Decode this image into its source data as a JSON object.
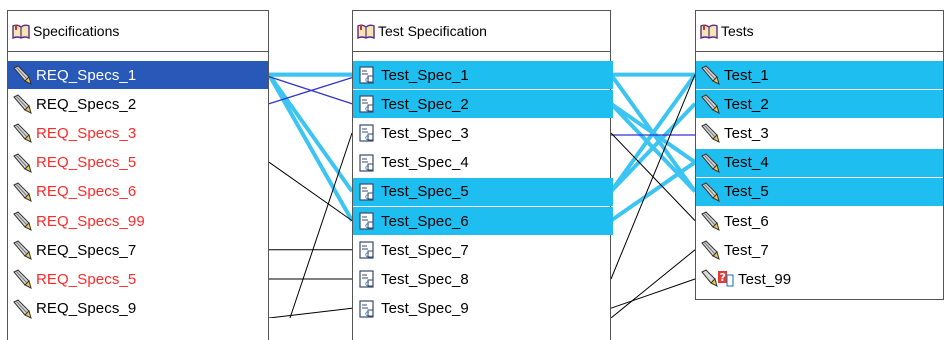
{
  "panels": {
    "specifications": {
      "title": "Specifications",
      "items": [
        {
          "label": "REQ_Specs_1",
          "color": "#ffffff",
          "state": "selected"
        },
        {
          "label": "REQ_Specs_2",
          "color": "#000000",
          "state": "normal"
        },
        {
          "label": "REQ_Specs_3",
          "color": "#ff2a2a",
          "state": "normal"
        },
        {
          "label": "REQ_Specs_5",
          "color": "#ff2a2a",
          "state": "normal"
        },
        {
          "label": "REQ_Specs_6",
          "color": "#ff2a2a",
          "state": "normal"
        },
        {
          "label": "REQ_Specs_99",
          "color": "#ff2a2a",
          "state": "normal"
        },
        {
          "label": "REQ_Specs_7",
          "color": "#000000",
          "state": "normal"
        },
        {
          "label": "REQ_Specs_5",
          "color": "#ff2a2a",
          "state": "normal"
        },
        {
          "label": "REQ_Specs_9",
          "color": "#000000",
          "state": "normal"
        }
      ]
    },
    "test_specification": {
      "title": "Test Specification",
      "items": [
        {
          "label": "Test_Spec_1",
          "state": "highlighted"
        },
        {
          "label": "Test_Spec_2",
          "state": "highlighted"
        },
        {
          "label": "Test_Spec_3",
          "state": "normal"
        },
        {
          "label": "Test_Spec_4",
          "state": "normal"
        },
        {
          "label": "Test_Spec_5",
          "state": "highlighted"
        },
        {
          "label": "Test_Spec_6",
          "state": "highlighted"
        },
        {
          "label": "Test_Spec_7",
          "state": "normal"
        },
        {
          "label": "Test_Spec_8",
          "state": "normal"
        },
        {
          "label": "Test_Spec_9",
          "state": "normal"
        }
      ]
    },
    "tests": {
      "title": "Tests",
      "items": [
        {
          "label": "Test_1",
          "state": "highlighted"
        },
        {
          "label": "Test_2",
          "state": "highlighted"
        },
        {
          "label": "Test_3",
          "state": "normal"
        },
        {
          "label": "Test_4",
          "state": "highlighted"
        },
        {
          "label": "Test_5",
          "state": "highlighted"
        },
        {
          "label": "Test_6",
          "state": "normal"
        },
        {
          "label": "Test_7",
          "state": "normal"
        },
        {
          "label": "Test_99",
          "state": "missing"
        }
      ]
    }
  },
  "icons": {
    "panel_header": "book-icon",
    "specification_item": "pencil-icon",
    "test_spec_item": "document-icon",
    "test_item": "pencil-icon",
    "missing_item": "missing-link-icon"
  },
  "colors": {
    "selection": "#2859b8",
    "highlight": "#1fbef0",
    "link_highlight": "#3cc4f2",
    "link_selected": "#3333cc",
    "link_normal": "#000000",
    "missing_text": "#ff2a2a"
  }
}
